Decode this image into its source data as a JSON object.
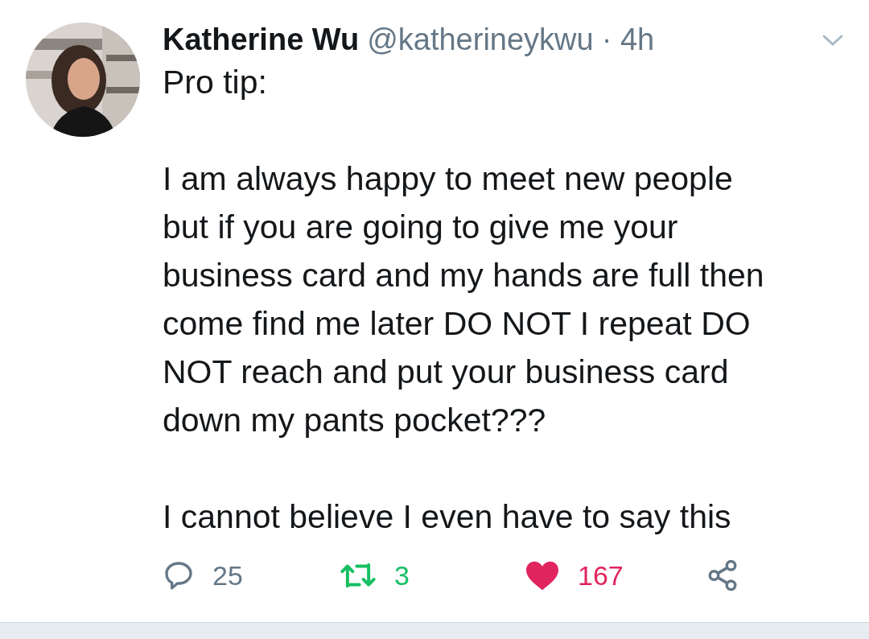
{
  "tweet": {
    "name": "Katherine Wu",
    "handle": "@katherineykwu",
    "time": "· 4h",
    "paragraphs": [
      {
        "lines": [
          "Pro tip:"
        ]
      },
      {
        "lines": [
          "I am always happy to meet new people",
          "but if you are going to give me your",
          "business card and my hands are full then",
          "come find me later DO NOT I repeat DO",
          "NOT reach and put your business card",
          "down my pants pocket???"
        ]
      },
      {
        "lines": [
          "I cannot believe I even have to say this"
        ]
      }
    ],
    "actions": [
      {
        "kind": "reply",
        "count": "25",
        "active": false
      },
      {
        "kind": "retweet",
        "count": "3",
        "active": true
      },
      {
        "kind": "like",
        "count": "167",
        "active": true
      },
      {
        "kind": "share",
        "active": false
      }
    ]
  }
}
